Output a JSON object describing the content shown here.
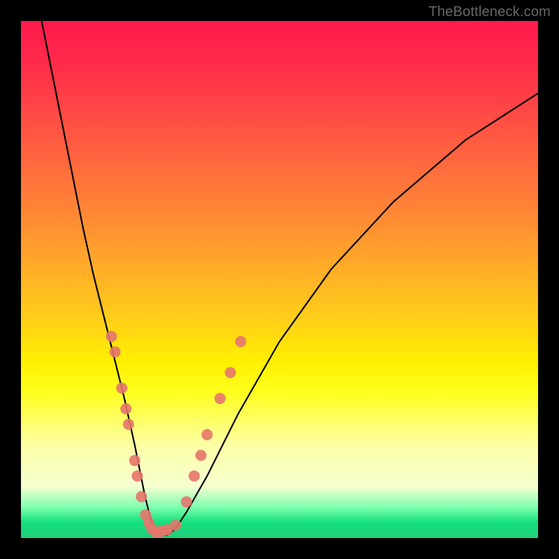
{
  "watermark": "TheBottleneck.com",
  "chart_data": {
    "type": "line",
    "title": "",
    "xlabel": "",
    "ylabel": "",
    "xlim": [
      0,
      100
    ],
    "ylim": [
      0,
      100
    ],
    "series": [
      {
        "name": "bottleneck-curve",
        "x": [
          4,
          6,
          8,
          10,
          12,
          14,
          16,
          18,
          20,
          22,
          23,
          24,
          25,
          26,
          27,
          28,
          29,
          30,
          32,
          36,
          42,
          50,
          60,
          72,
          86,
          100
        ],
        "values": [
          100,
          90,
          80,
          70,
          60,
          51,
          43,
          35,
          27,
          18,
          13,
          8,
          4,
          1.5,
          0.5,
          0.5,
          1,
          2,
          5,
          12,
          24,
          38,
          52,
          65,
          77,
          86
        ]
      }
    ],
    "markers": {
      "name": "highlight-dots",
      "color": "#e5766d",
      "points": [
        {
          "x": 17.5,
          "y": 39
        },
        {
          "x": 18.2,
          "y": 36
        },
        {
          "x": 19.5,
          "y": 29
        },
        {
          "x": 20.3,
          "y": 25
        },
        {
          "x": 20.8,
          "y": 22
        },
        {
          "x": 22.0,
          "y": 15
        },
        {
          "x": 22.5,
          "y": 12
        },
        {
          "x": 23.3,
          "y": 8
        },
        {
          "x": 24.1,
          "y": 4.5
        },
        {
          "x": 24.7,
          "y": 3
        },
        {
          "x": 25.3,
          "y": 1.8
        },
        {
          "x": 26.0,
          "y": 1.2
        },
        {
          "x": 26.8,
          "y": 1.2
        },
        {
          "x": 27.5,
          "y": 1.4
        },
        {
          "x": 28.3,
          "y": 1.6
        },
        {
          "x": 29.9,
          "y": 2.5
        },
        {
          "x": 32.0,
          "y": 7
        },
        {
          "x": 33.5,
          "y": 12
        },
        {
          "x": 34.8,
          "y": 16
        },
        {
          "x": 36.0,
          "y": 20
        },
        {
          "x": 38.5,
          "y": 27
        },
        {
          "x": 40.5,
          "y": 32
        },
        {
          "x": 42.5,
          "y": 38
        }
      ]
    }
  }
}
